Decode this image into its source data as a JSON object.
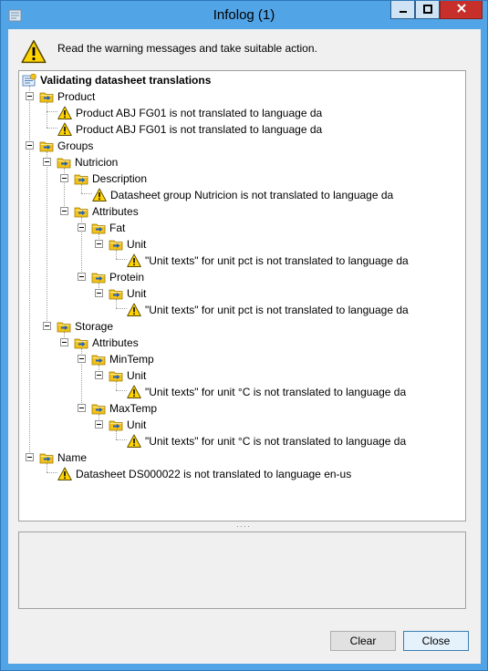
{
  "window": {
    "title": "Infolog (1)",
    "message": "Read the warning messages and take suitable action."
  },
  "tree": {
    "root": "Validating datasheet translations",
    "product": {
      "label": "Product",
      "warnings": [
        "Product ABJ FG01 is not translated to language da",
        "Product ABJ FG01 is not translated to language da"
      ]
    },
    "groups": {
      "label": "Groups",
      "nutricion": {
        "label": "Nutricion",
        "description": {
          "label": "Description",
          "warning": "Datasheet group Nutricion is not translated to language da"
        },
        "attributes": {
          "label": "Attributes",
          "fat": {
            "label": "Fat",
            "unit": "Unit",
            "warning": "\"Unit texts\" for unit pct is not translated to language da"
          },
          "protein": {
            "label": "Protein",
            "unit": "Unit",
            "warning": "\"Unit texts\" for unit pct is not translated to language da"
          }
        }
      },
      "storage": {
        "label": "Storage",
        "attributes": {
          "label": "Attributes",
          "mintemp": {
            "label": "MinTemp",
            "unit": "Unit",
            "warning": "\"Unit texts\" for unit °C is not translated to language da"
          },
          "maxtemp": {
            "label": "MaxTemp",
            "unit": "Unit",
            "warning": "\"Unit texts\" for unit °C is not translated to language da"
          }
        }
      }
    },
    "name": {
      "label": "Name",
      "warning": "Datasheet DS000022 is not translated to language en-us"
    }
  },
  "buttons": {
    "clear": "Clear",
    "close": "Close"
  },
  "icons": {
    "app": "infolog-app-icon",
    "warning": "warning-triangle-icon",
    "folder": "folder-arrow-icon",
    "root": "infolog-root-icon"
  },
  "colors": {
    "title_bar": "#51a4e6",
    "close_button": "#c7302a",
    "warning_yellow": "#ffd400",
    "folder_yellow": "#f2c21a",
    "arrow_blue": "#1f5fbf"
  }
}
